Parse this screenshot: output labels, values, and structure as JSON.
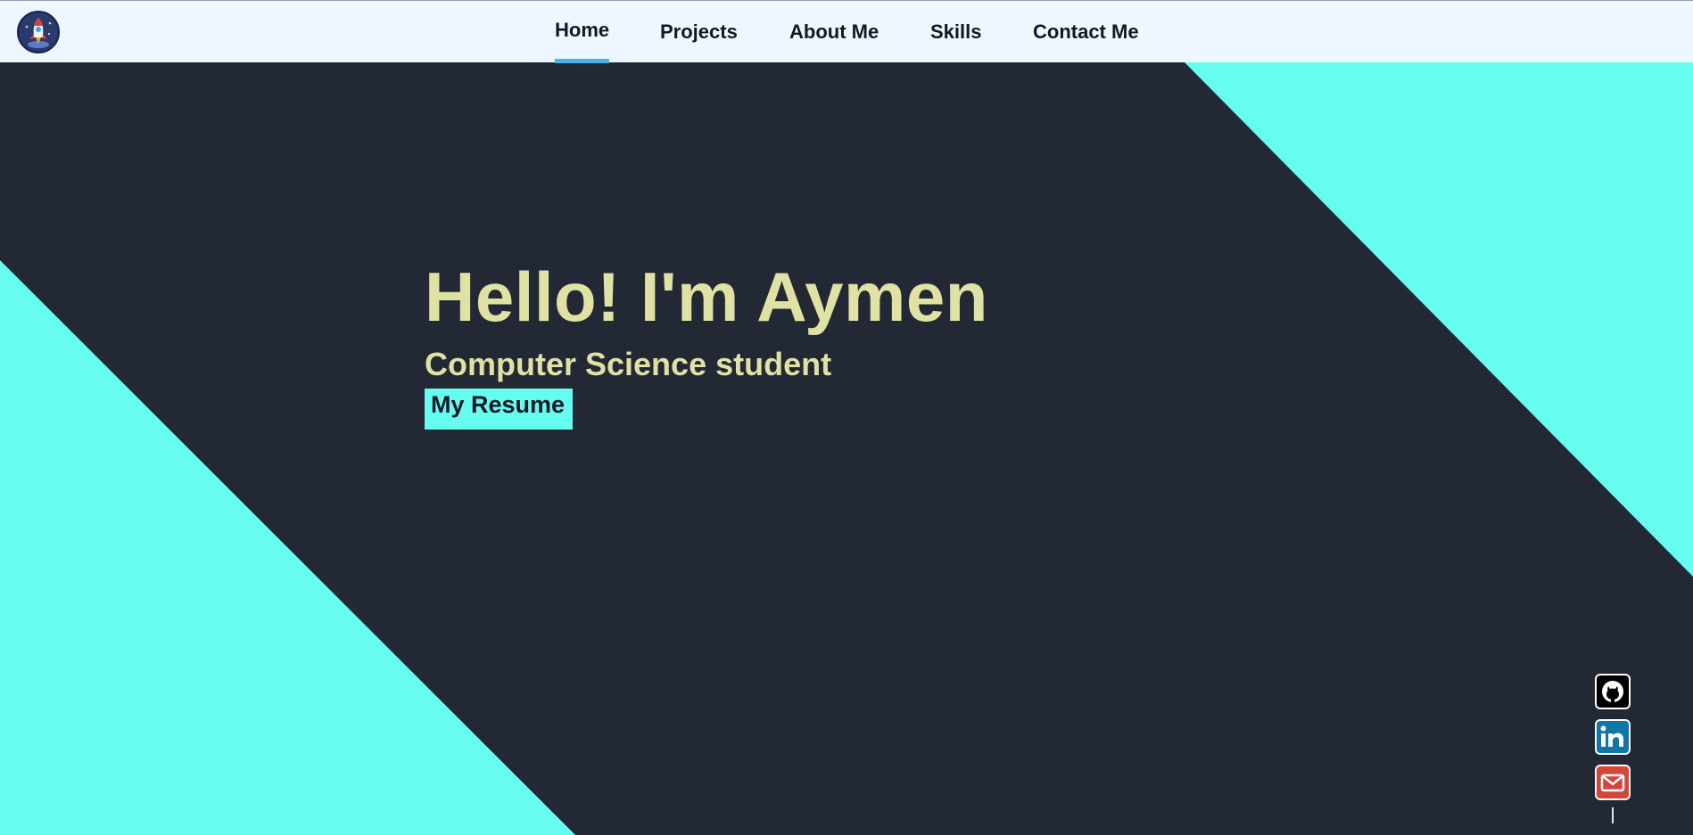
{
  "header": {
    "logo_icon": "rocket-logo-icon",
    "nav": [
      {
        "label": "Home",
        "active": true
      },
      {
        "label": "Projects",
        "active": false
      },
      {
        "label": "About Me",
        "active": false
      },
      {
        "label": "Skills",
        "active": false
      },
      {
        "label": "Contact Me",
        "active": false
      }
    ]
  },
  "hero": {
    "title": "Hello! I'm Aymen",
    "subtitle": "Computer Science student",
    "resume_button": "My Resume"
  },
  "social": [
    {
      "icon": "github-icon"
    },
    {
      "icon": "linkedin-icon"
    },
    {
      "icon": "email-icon"
    }
  ],
  "colors": {
    "background": "#222834",
    "accent": "#66fdf0",
    "hero_text": "#e0e2a4",
    "header_bg": "#eef6ff",
    "nav_underline": "#4fb3e6"
  }
}
